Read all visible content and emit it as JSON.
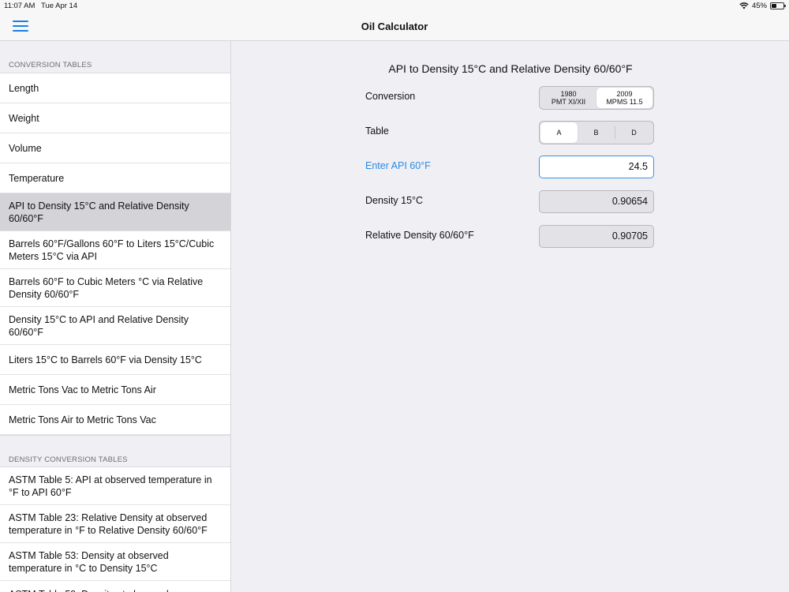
{
  "status": {
    "time": "11:07 AM",
    "date": "Tue Apr 14",
    "battery": "45%",
    "battery_level": 0.45
  },
  "app": {
    "title": "Oil Calculator"
  },
  "sidebar": {
    "section1": "CONVERSION TABLES",
    "items1": [
      "Length",
      "Weight",
      "Volume",
      "Temperature",
      "API to Density 15°C and Relative Density 60/60°F",
      "Barrels 60°F/Gallons 60°F to Liters 15°C/Cubic Meters 15°C via API",
      "Barrels 60°F to Cubic Meters °C via Relative Density 60/60°F",
      "Density 15°C to API and Relative Density 60/60°F",
      "Liters 15°C to Barrels 60°F via Density 15°C",
      "Metric Tons Vac to Metric Tons Air",
      "Metric Tons Air to Metric Tons Vac"
    ],
    "section2": "DENSITY CONVERSION TABLES",
    "items2": [
      "ASTM Table 5: API at observed temperature in °F to API 60°F",
      "ASTM Table 23: Relative Density at observed temperature in °F to Relative Density 60/60°F",
      "ASTM Table 53: Density at observed temperature in °C to Density 15°C",
      "ASTM Table 59: Density at observed"
    ]
  },
  "main": {
    "title": "API to Density 15°C and Relative Density 60/60°F",
    "conversion_label": "Conversion",
    "conversion_options": [
      {
        "line1": "1980",
        "line2": "PMT XI/XII"
      },
      {
        "line1": "2009",
        "line2": "MPMS 11.5"
      }
    ],
    "table_label": "Table",
    "table_options": [
      "A",
      "B",
      "D"
    ],
    "input_label": "Enter API 60°F",
    "input_value": "24.5",
    "density_label": "Density 15°C",
    "density_value": "0.90654",
    "rel_density_label": "Relative Density 60/60°F",
    "rel_density_value": "0.90705"
  },
  "colors": {
    "accent": "#1a7fe6",
    "selected_row": "#d4d4d8",
    "background": "#efeff4"
  }
}
